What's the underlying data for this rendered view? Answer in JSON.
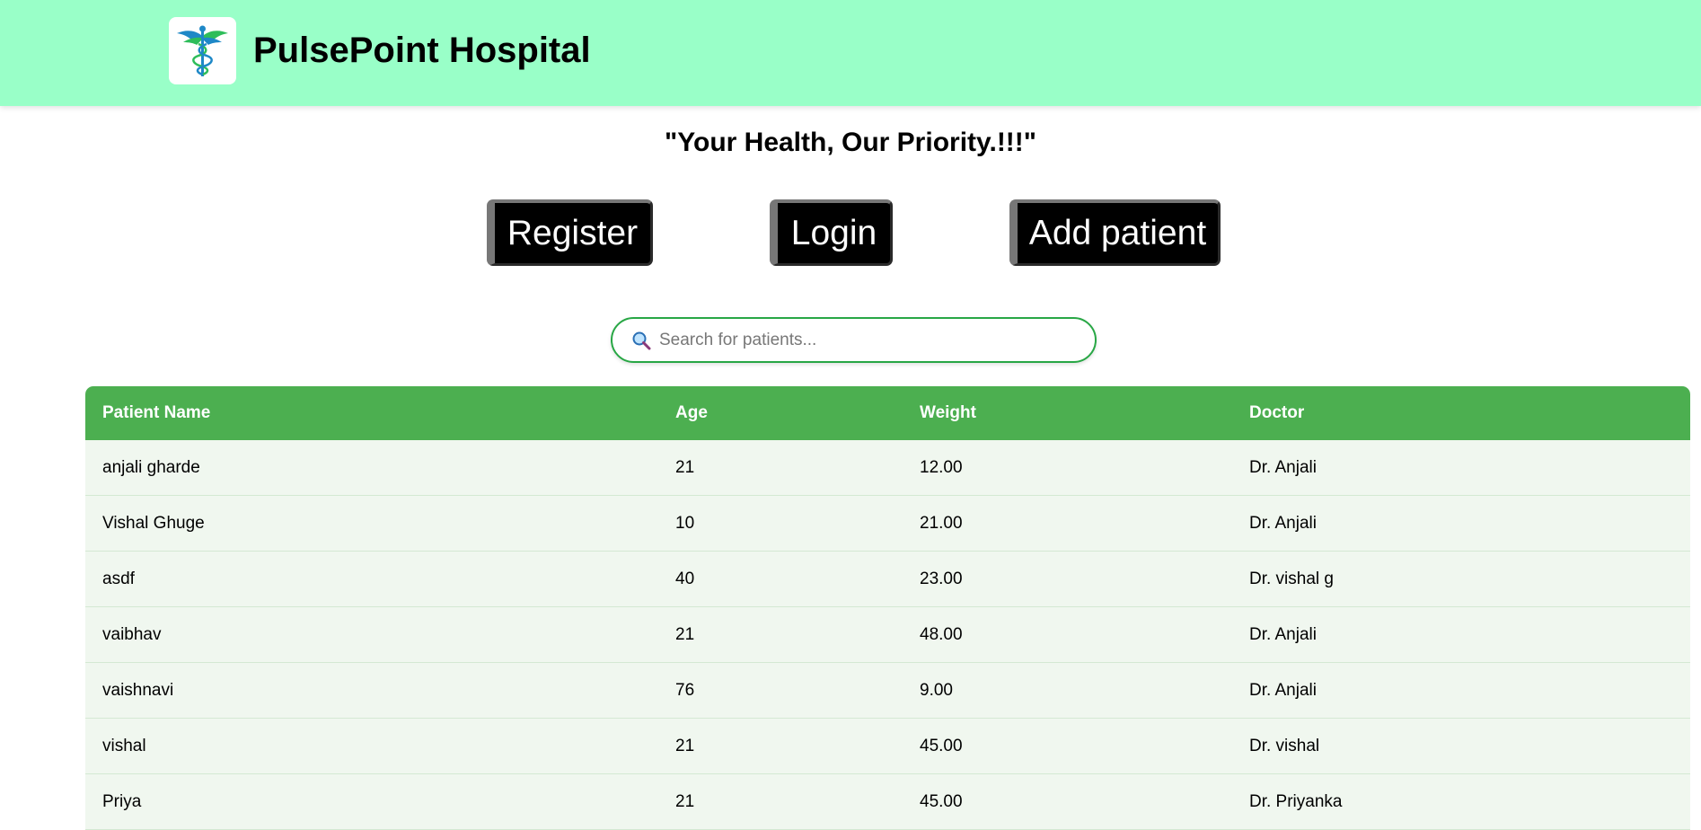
{
  "header": {
    "title": "PulsePoint Hospital",
    "logo_icon": "caduceus-icon"
  },
  "tagline": "\"Your Health, Our Priority.!!!\"",
  "actions": {
    "register_label": "Register",
    "login_label": "Login",
    "add_patient_label": "Add patient"
  },
  "search": {
    "icon": "magnifier-icon",
    "placeholder": "Search for patients...",
    "value": ""
  },
  "table": {
    "columns": [
      "Patient Name",
      "Age",
      "Weight",
      "Doctor"
    ],
    "rows": [
      [
        "anjali gharde",
        "21",
        "12.00",
        "Dr. Anjali"
      ],
      [
        "Vishal Ghuge",
        "10",
        "21.00",
        "Dr. Anjali"
      ],
      [
        "asdf",
        "40",
        "23.00",
        "Dr. vishal g"
      ],
      [
        "vaibhav",
        "21",
        "48.00",
        "Dr. Anjali"
      ],
      [
        "vaishnavi",
        "76",
        "9.00",
        "Dr. Anjali"
      ],
      [
        "vishal",
        "21",
        "45.00",
        "Dr. vishal"
      ],
      [
        "Priya",
        "21",
        "45.00",
        "Dr. Priyanka"
      ]
    ]
  },
  "colors": {
    "header_bg": "#99ffc8",
    "table_header_bg": "#4caf50",
    "row_bg": "#f0f7ef",
    "search_border": "#28a745",
    "button_bg": "#000000"
  }
}
